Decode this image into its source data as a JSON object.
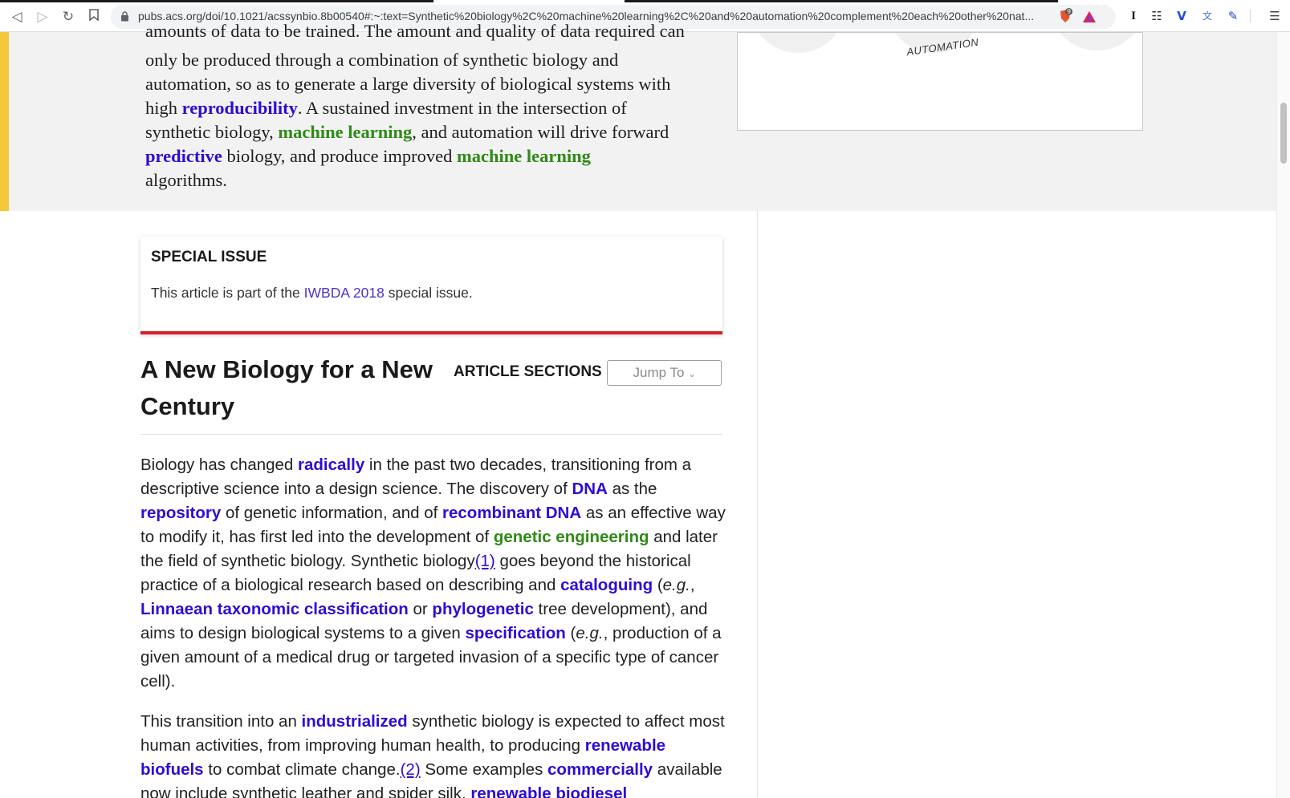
{
  "browser": {
    "url": "pubs.acs.org/doi/10.1021/acssynbio.8b00540#:~:text=Synthetic%20biology%2C%20machine%20learning%2C%20and%20automation%20complement%20each%20other%20nat...",
    "icons": [
      "back-icon",
      "forward-icon",
      "reload-icon",
      "bookmark-icon",
      "lock-icon",
      "brave-shield-icon",
      "brave-rewards-icon",
      "text-cursor-icon",
      "extension-icon",
      "vpn-icon",
      "translate-icon",
      "pen-icon",
      "menu-icon"
    ],
    "shield_count": "9"
  },
  "abstract": {
    "line1": "amounts of data to be trained. The amount and quality of data required can",
    "line2": "only be produced through a combination of synthetic biology and",
    "line3": "automation, so as to generate a large diversity of biological systems with",
    "line4_a": "high ",
    "line4_link": "reproducibility",
    "line4_b": ". A sustained investment in the intersection of",
    "line5_a": "synthetic biology, ",
    "line5_link": "machine learning",
    "line5_b": ", and automation will drive forward",
    "line6_link1": "predictive",
    "line6_a": " biology, and produce improved ",
    "line6_link2": "machine learning",
    "line7": "algorithms."
  },
  "figure": {
    "automation_label": "AUTOMATION"
  },
  "special_issue": {
    "title": "SPECIAL ISSUE",
    "text_before": "This article is part of the ",
    "link": "IWBDA 2018",
    "text_after": " special issue."
  },
  "section": {
    "heading": "A New Biology for a New Century",
    "sections_label": "ARTICLE SECTIONS",
    "jump_to": "Jump To"
  },
  "paragraph1": {
    "t1": "Biology has changed ",
    "k1": "radically",
    "t2": " in the past two decades, transitioning from a descriptive science into a design science. The discovery of ",
    "k2": "DNA",
    "t3": " as the ",
    "k3": "repository",
    "t4": " of genetic information, and of ",
    "k4": "recombinant DNA",
    "t5": " as an effective way to modify it, has first led into the development of ",
    "k5": "genetic engineering",
    "t6": " and later the field of synthetic biology. Synthetic biology",
    "ref1": "(1)",
    "t7": " goes beyond the historical practice of a biological research based on describing and ",
    "k6": "cataloguing",
    "t8": " (",
    "eg1": "e.g.",
    "t9": ", ",
    "k7": "Linnaean taxonomic classification",
    "t10": " or ",
    "k8": "phylogenetic",
    "t11": " tree development), and aims to design biological systems to a given ",
    "k9": "specification",
    "t12": " (",
    "eg2": "e.g.",
    "t13": ", production of a given amount of a medical drug or targeted invasion of a specific type of cancer cell)."
  },
  "paragraph2": {
    "t1": "This transition into an ",
    "k1": "industrialized",
    "t2": " synthetic biology is expected to affect most human activities, from improving human health, to producing ",
    "k2": "renewable biofuels",
    "t3": " to combat climate change.",
    "ref2": "(2)",
    "t4": " Some examples ",
    "k3": "commercially",
    "t5": " available now include synthetic leather and spider silk, ",
    "k4": "renewable biodiesel"
  }
}
